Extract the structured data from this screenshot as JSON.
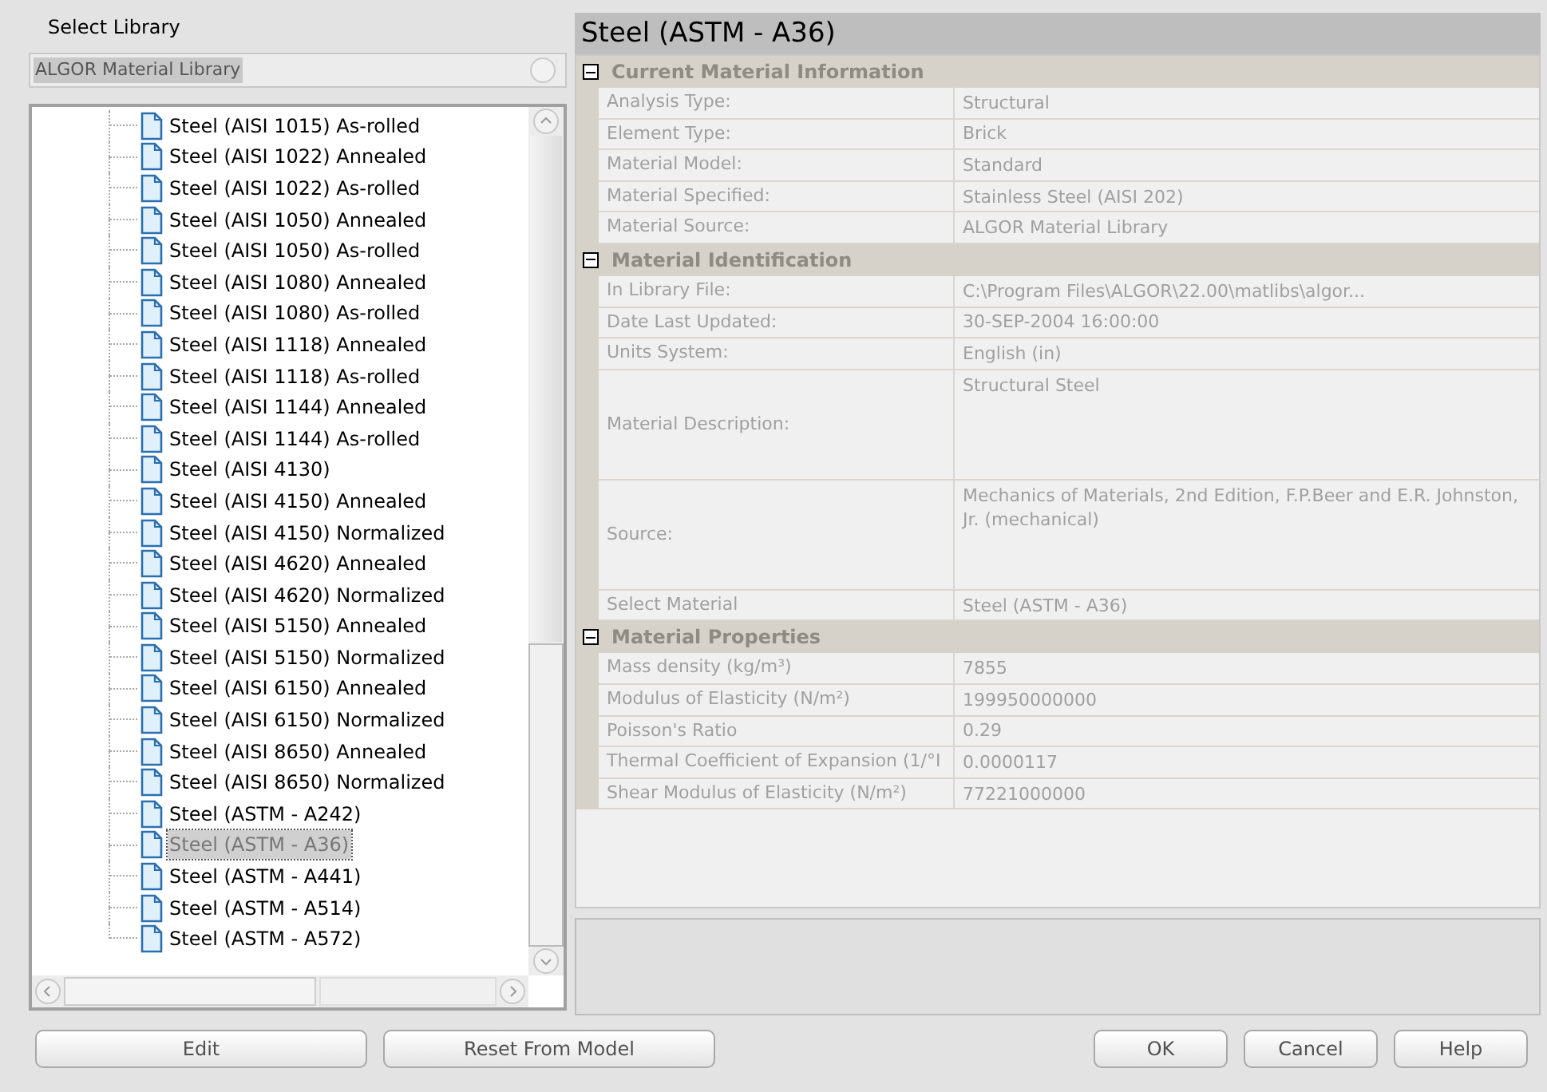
{
  "library": {
    "label": "Select Library",
    "value": "ALGOR Material Library"
  },
  "tree": {
    "items": [
      {
        "label": "Steel (AISI 1015) As-rolled",
        "selected": false
      },
      {
        "label": "Steel (AISI 1022) Annealed",
        "selected": false
      },
      {
        "label": "Steel (AISI 1022) As-rolled",
        "selected": false
      },
      {
        "label": "Steel (AISI 1050) Annealed",
        "selected": false
      },
      {
        "label": "Steel (AISI 1050) As-rolled",
        "selected": false
      },
      {
        "label": "Steel (AISI 1080) Annealed",
        "selected": false
      },
      {
        "label": "Steel (AISI 1080) As-rolled",
        "selected": false
      },
      {
        "label": "Steel (AISI 1118) Annealed",
        "selected": false
      },
      {
        "label": "Steel (AISI 1118) As-rolled",
        "selected": false
      },
      {
        "label": "Steel (AISI 1144) Annealed",
        "selected": false
      },
      {
        "label": "Steel (AISI 1144) As-rolled",
        "selected": false
      },
      {
        "label": "Steel (AISI 4130)",
        "selected": false
      },
      {
        "label": "Steel (AISI 4150) Annealed",
        "selected": false
      },
      {
        "label": "Steel (AISI 4150) Normalized",
        "selected": false
      },
      {
        "label": "Steel (AISI 4620) Annealed",
        "selected": false
      },
      {
        "label": "Steel (AISI 4620) Normalized",
        "selected": false
      },
      {
        "label": "Steel (AISI 5150) Annealed",
        "selected": false
      },
      {
        "label": "Steel (AISI 5150) Normalized",
        "selected": false
      },
      {
        "label": "Steel (AISI 6150) Annealed",
        "selected": false
      },
      {
        "label": "Steel (AISI 6150) Normalized",
        "selected": false
      },
      {
        "label": "Steel (AISI 8650) Annealed",
        "selected": false
      },
      {
        "label": "Steel (AISI 8650) Normalized",
        "selected": false
      },
      {
        "label": "Steel (ASTM - A242)",
        "selected": false
      },
      {
        "label": "Steel (ASTM - A36)",
        "selected": true
      },
      {
        "label": "Steel (ASTM - A441)",
        "selected": false
      },
      {
        "label": "Steel (ASTM - A514)",
        "selected": false
      },
      {
        "label": "Steel (ASTM - A572)",
        "selected": false
      }
    ]
  },
  "grid": {
    "title": "Steel (ASTM - A36)",
    "sections": [
      {
        "title": "Current Material Information",
        "expanded": true,
        "rows": [
          {
            "kind": "single",
            "label": "Analysis Type:",
            "value": "Structural"
          },
          {
            "kind": "single",
            "label": "Element Type:",
            "value": "Brick"
          },
          {
            "kind": "single",
            "label": "Material Model:",
            "value": "Standard"
          },
          {
            "kind": "single",
            "label": "Material Specified:",
            "value": "Stainless Steel (AISI 202)"
          },
          {
            "kind": "single",
            "label": "Material Source:",
            "value": "ALGOR Material Library"
          }
        ]
      },
      {
        "title": "Material Identification",
        "expanded": true,
        "rows": [
          {
            "kind": "single",
            "label": "In Library File:",
            "value": "C:\\Program Files\\ALGOR\\22.00\\matlibs\\algor..."
          },
          {
            "kind": "single",
            "label": "Date Last Updated:",
            "value": "30-SEP-2004 16:00:00"
          },
          {
            "kind": "single",
            "label": "Units System:",
            "value": "English (in)"
          },
          {
            "kind": "multiline",
            "label": "Material Description:",
            "value": "Structural Steel"
          },
          {
            "kind": "multiline",
            "label": "Source:",
            "value": "Mechanics of Materials, 2nd Edition, F.P.Beer and E.R. Johnston, Jr. (mechanical)"
          },
          {
            "kind": "single",
            "label": "Select Material",
            "value": "Steel (ASTM - A36)"
          }
        ]
      },
      {
        "title": "Material Properties",
        "expanded": true,
        "rows": [
          {
            "kind": "single",
            "label": "Mass density (kg/m³)",
            "value": "7855"
          },
          {
            "kind": "single",
            "label": "Modulus of Elasticity (N/m²)",
            "value": "199950000000"
          },
          {
            "kind": "single",
            "label": "Poisson's Ratio",
            "value": "0.29"
          },
          {
            "kind": "single",
            "label": "Thermal Coefficient of Expansion (1/°I",
            "value": "0.0000117"
          },
          {
            "kind": "single",
            "label": "Shear Modulus of Elasticity (N/m²)",
            "value": "77221000000"
          }
        ]
      }
    ]
  },
  "left_buttons": [
    "Edit",
    "Reset From Model"
  ],
  "right_buttons": [
    "OK",
    "Cancel",
    "Help"
  ]
}
